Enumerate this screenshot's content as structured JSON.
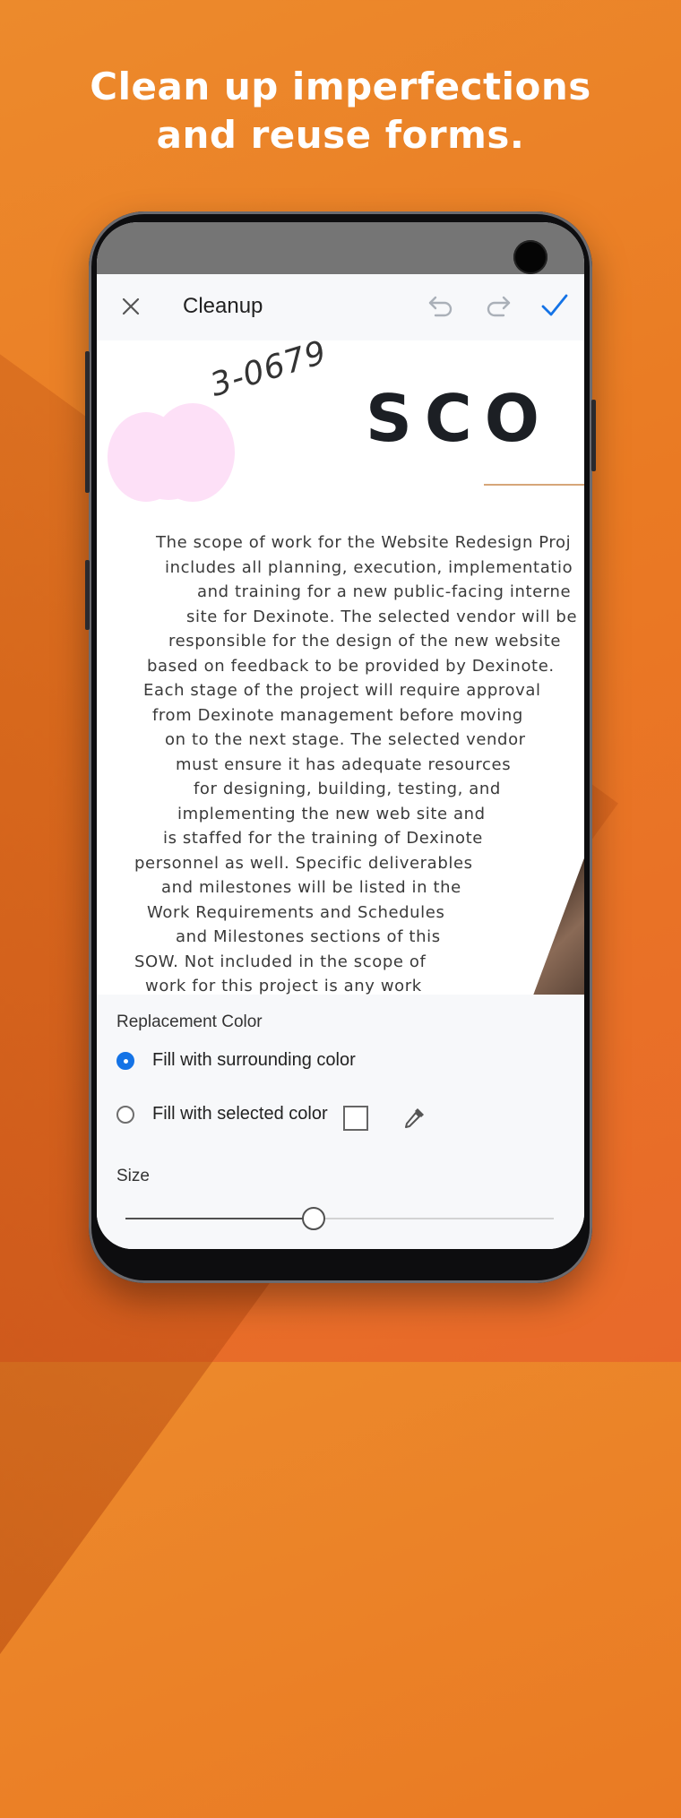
{
  "headline": {
    "line1": "Clean up imperfections",
    "line2": "and reuse forms."
  },
  "app": {
    "title": "Cleanup",
    "accent_color": "#1473e6",
    "icons": [
      "close-icon",
      "undo-icon",
      "redo-icon",
      "check-icon",
      "eyedropper-icon"
    ]
  },
  "document": {
    "phone_fragment": "3-0679",
    "heading_fragment": "SCO",
    "paragraph_lines": [
      "The scope of work for the Website Redesign Proj",
      "includes all planning, execution, implementatio",
      "and training for a new public-facing interne",
      "site for Dexinote. The selected vendor will be",
      "responsible for the design of the new website",
      "based on feedback to be provided by Dexinote.",
      "Each stage of the project will require approval",
      "from Dexinote management before moving",
      "on to the next stage. The selected vendor",
      "must ensure it has adequate resources",
      "for designing, building, testing, and",
      "implementing the new web site and",
      "is staffed for the training of Dexinote",
      "personnel as well. Specific deliverables",
      "and milestones will be listed in the",
      "Work Requirements and Schedules",
      "and Milestones sections of this",
      "SOW. Not included in the scope of",
      "work for this project is any work"
    ],
    "blob_color": "#fde0f7"
  },
  "panel": {
    "replacement_label": "Replacement Color",
    "option_surrounding": "Fill with surrounding color",
    "option_selected": "Fill with selected color",
    "selected_option": "surrounding",
    "size_label": "Size",
    "size_value": 0.44
  }
}
